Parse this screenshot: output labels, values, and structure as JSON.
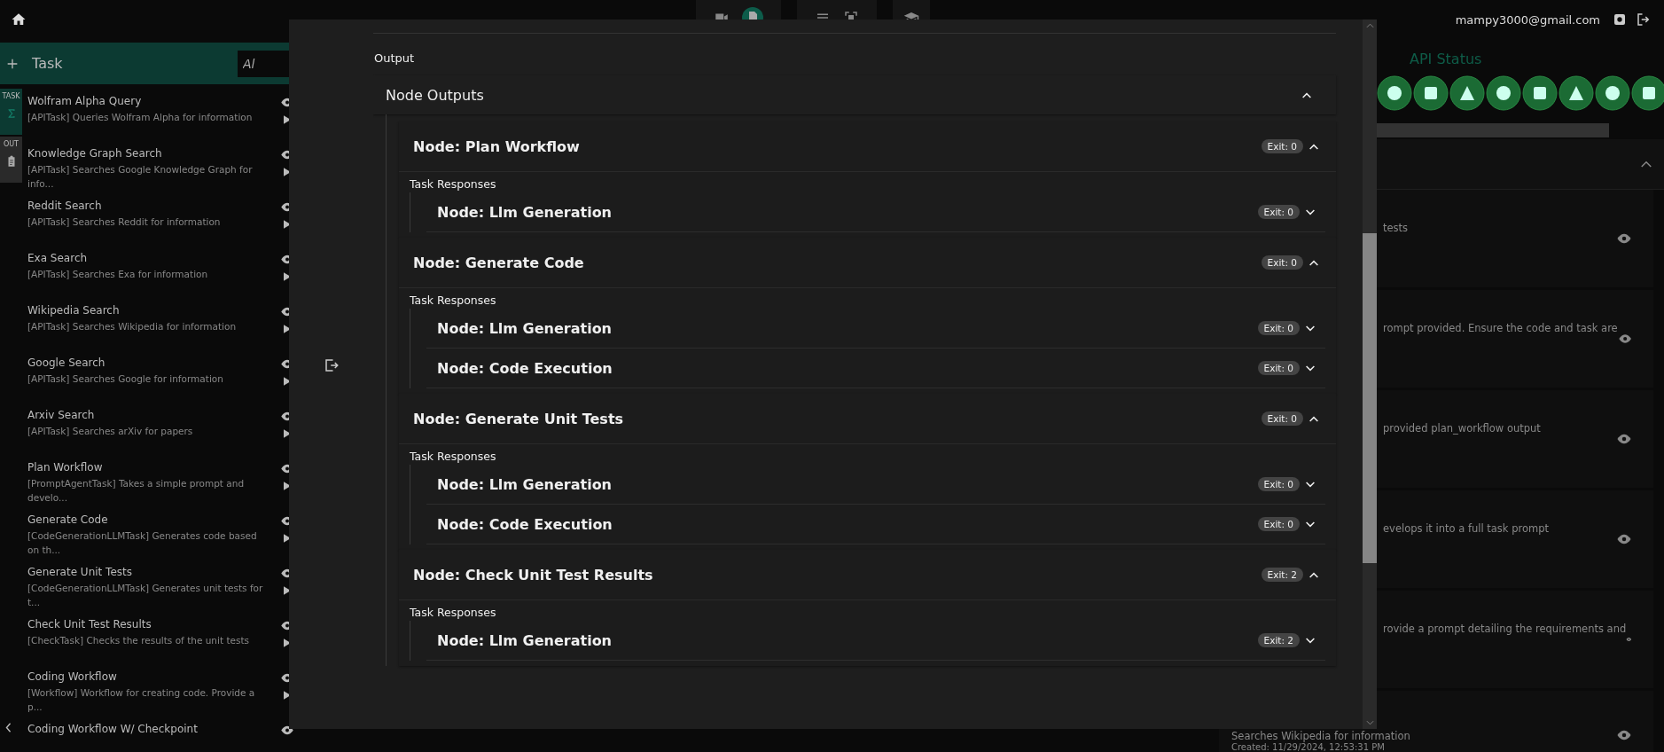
{
  "topbar": {
    "user_email": "mampy3000@gmail.com"
  },
  "sidebar": {
    "title": "Task",
    "search_placeholder": "Al",
    "side_tabs": [
      {
        "label": "TASK",
        "selected": true
      },
      {
        "label": "OUT",
        "selected": false
      }
    ],
    "items": [
      {
        "name": "Wolfram Alpha Query",
        "desc": "[APITask] Queries Wolfram Alpha for information"
      },
      {
        "name": "Knowledge Graph Search",
        "desc": "[APITask] Searches Google Knowledge Graph for info..."
      },
      {
        "name": "Reddit Search",
        "desc": "[APITask] Searches Reddit for information"
      },
      {
        "name": "Exa Search",
        "desc": "[APITask] Searches Exa for information"
      },
      {
        "name": "Wikipedia Search",
        "desc": "[APITask] Searches Wikipedia for information"
      },
      {
        "name": "Google Search",
        "desc": "[APITask] Searches Google for information"
      },
      {
        "name": "Arxiv Search",
        "desc": "[APITask] Searches arXiv for papers"
      },
      {
        "name": "Plan Workflow",
        "desc": "[PromptAgentTask] Takes a simple prompt and develo..."
      },
      {
        "name": "Generate Code",
        "desc": "[CodeGenerationLLMTask] Generates code based on th..."
      },
      {
        "name": "Generate Unit Tests",
        "desc": "[CodeGenerationLLMTask] Generates unit tests for t..."
      },
      {
        "name": "Check Unit Test Results",
        "desc": "[CheckTask] Checks the results of the unit tests"
      },
      {
        "name": "Coding Workflow",
        "desc": "[Workflow] Workflow for creating code. Provide a p..."
      },
      {
        "name": "Coding Workflow W/ Checkpoint"
      }
    ]
  },
  "api_status": {
    "title": "API Status"
  },
  "right_items": [
    {
      "lines": [
        "tests"
      ]
    },
    {
      "lines": [
        "rompt provided. Ensure the code and task are"
      ]
    },
    {
      "lines": [
        "provided plan_workflow output"
      ]
    },
    {
      "lines": [
        "evelops it into a full task prompt"
      ]
    },
    {
      "lines": [
        "rovide a prompt detailing the requirements and"
      ]
    },
    {
      "lines": [
        "Searches Wikipedia for information",
        "Created: 11/29/2024, 12:53:31 PM"
      ]
    }
  ],
  "modal": {
    "section_label": "Output",
    "accordion": {
      "title": "Node Outputs",
      "expanded": true,
      "nodes": [
        {
          "title": "Node: Plan Workflow",
          "exit": "Exit: 0",
          "expanded": true,
          "responses_label": "Task Responses",
          "children": [
            {
              "title": "Node: Llm Generation",
              "exit": "Exit: 0",
              "expanded": false
            }
          ]
        },
        {
          "title": "Node: Generate Code",
          "exit": "Exit: 0",
          "expanded": true,
          "responses_label": "Task Responses",
          "children": [
            {
              "title": "Node: Llm Generation",
              "exit": "Exit: 0",
              "expanded": false
            },
            {
              "title": "Node: Code Execution",
              "exit": "Exit: 0",
              "expanded": false
            }
          ]
        },
        {
          "title": "Node: Generate Unit Tests",
          "exit": "Exit: 0",
          "expanded": true,
          "responses_label": "Task Responses",
          "children": [
            {
              "title": "Node: Llm Generation",
              "exit": "Exit: 0",
              "expanded": false
            },
            {
              "title": "Node: Code Execution",
              "exit": "Exit: 0",
              "expanded": false
            }
          ]
        },
        {
          "title": "Node: Check Unit Test Results",
          "exit": "Exit: 2",
          "expanded": true,
          "responses_label": "Task Responses",
          "children": [
            {
              "title": "Node: Llm Generation",
              "exit": "Exit: 2",
              "expanded": false
            }
          ]
        }
      ]
    }
  }
}
